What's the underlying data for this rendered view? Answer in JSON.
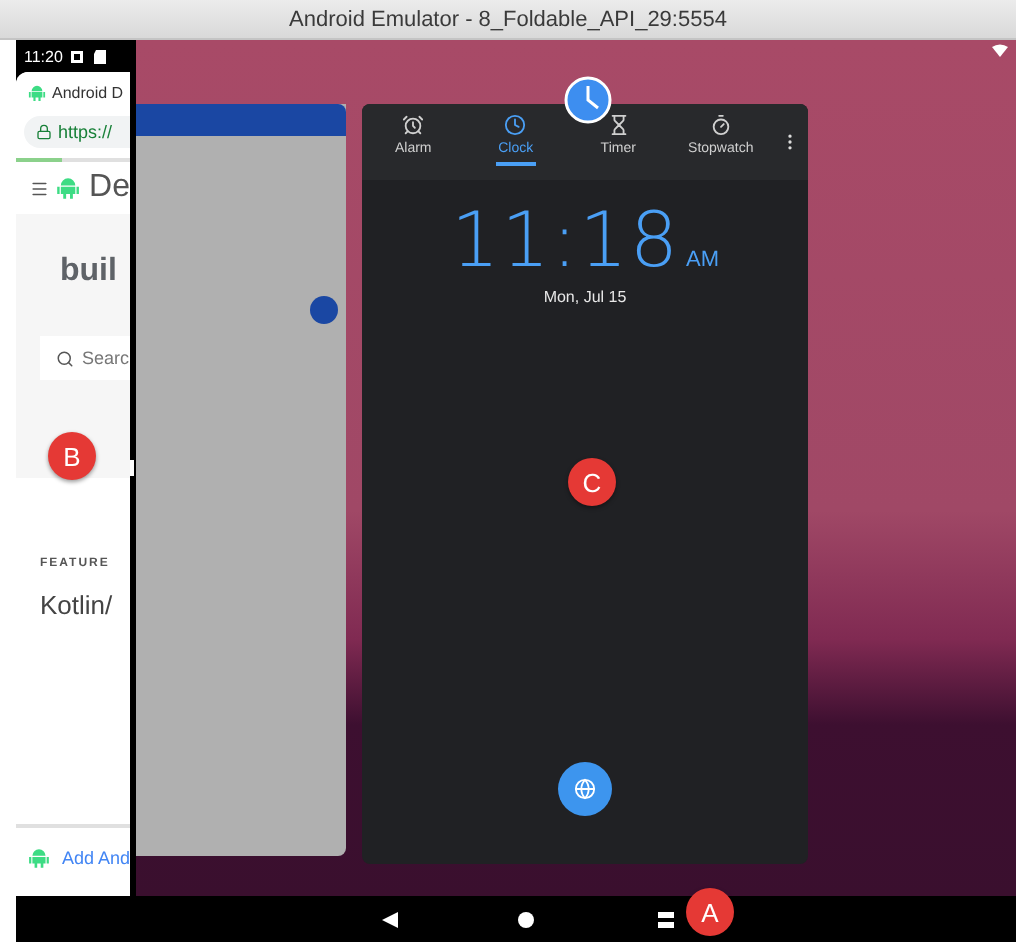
{
  "window": {
    "title": "Android Emulator - 8_Foldable_API_29:5554"
  },
  "left_screen": {
    "status_time": "11:20",
    "tab_title": "Android D",
    "url": "https://",
    "site_title": "De",
    "heading": "buil",
    "search_placeholder": "Searc",
    "section_label": "FEATURE",
    "section_title": "Kotlin/",
    "footer_link": "Add And",
    "progress": {
      "level": 0.4
    },
    "badge": "B"
  },
  "clock_app": {
    "tabs": [
      {
        "label": "Alarm",
        "selected": false
      },
      {
        "label": "Clock",
        "selected": true
      },
      {
        "label": "Timer",
        "selected": false
      },
      {
        "label": "Stopwatch",
        "selected": false
      }
    ],
    "time": "11:18",
    "period": "AM",
    "date": "Mon, Jul 15",
    "badge": "C"
  },
  "nav_bar": {
    "badge": "A"
  }
}
